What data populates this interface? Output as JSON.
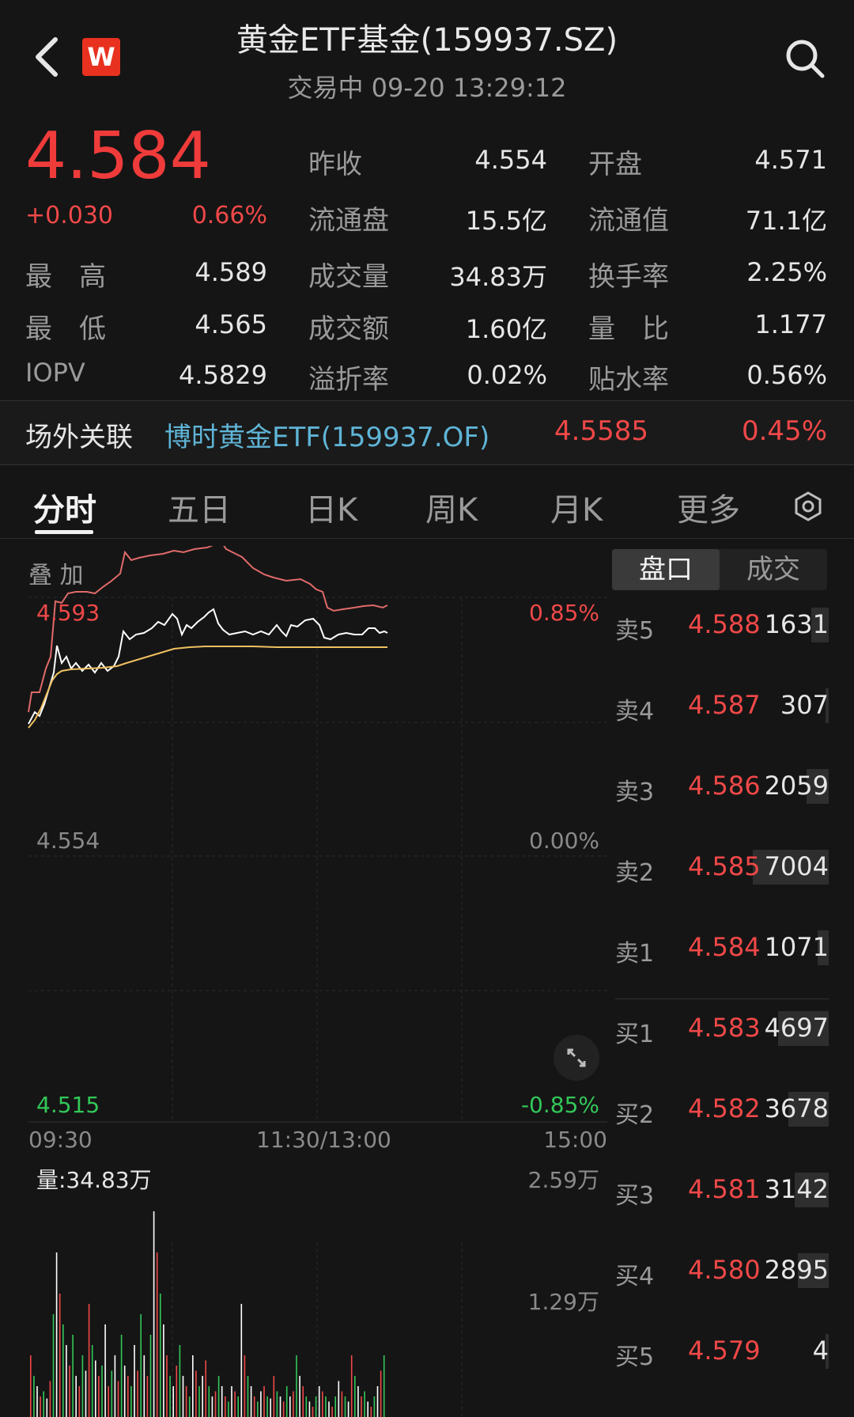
{
  "header": {
    "title": "黄金ETF基金(159937.SZ)",
    "status": "交易中 09-20 13:29:12",
    "logo_letter": "W"
  },
  "quote": {
    "price": "4.584",
    "change": "+0.030",
    "change_pct": "0.66%",
    "high_label": "最　高",
    "high": "4.589",
    "low_label": "最　低",
    "low": "4.565",
    "iopv_label": "IOPV",
    "iopv": "4.5829",
    "prev_close_label": "昨收",
    "prev_close": "4.554",
    "float_shares_label": "流通盘",
    "float_shares": "15.5亿",
    "volume_label": "成交量",
    "volume": "34.83万",
    "turnover_label": "成交额",
    "turnover": "1.60亿",
    "premium_label": "溢折率",
    "premium": "0.02%",
    "open_label": "开盘",
    "open": "4.571",
    "float_value_label": "流通值",
    "float_value": "71.1亿",
    "turnover_rate_label": "换手率",
    "turnover_rate": "2.25%",
    "volume_ratio_label": "量　比",
    "volume_ratio": "1.177",
    "discount_label": "贴水率",
    "discount": "0.56%"
  },
  "related": {
    "label": "场外关联",
    "fund": "博时黄金ETF(159937.OF)",
    "nav": "4.5585",
    "pct": "0.45%"
  },
  "tabs": [
    "分时",
    "五日",
    "日K",
    "周K",
    "月K",
    "更多"
  ],
  "chart": {
    "overlay_label": "叠 加",
    "y_high": "4.593",
    "y_mid": "4.554",
    "y_low": "4.515",
    "pct_high": "0.85%",
    "pct_mid": "0.00%",
    "pct_low": "-0.85%",
    "time_start": "09:30",
    "time_mid": "11:30/13:00",
    "time_end": "15:00",
    "volume_label": "量:34.83万",
    "vol_max": "2.59万",
    "vol_mid": "1.29万",
    "colors": {
      "price": "#ffffff",
      "avg": "#f0c060",
      "compare": "#e06a6a",
      "up": "#f04848",
      "down": "#33c759"
    }
  },
  "chart_data": {
    "type": "line",
    "x_range": [
      "09:30",
      "15:00"
    ],
    "ylim": [
      4.515,
      4.593
    ],
    "series": [],
    "volume_range": [
      0,
      25900
    ]
  },
  "orderbook": {
    "tabs": [
      "盘口",
      "成交"
    ],
    "asks": [
      {
        "side": "卖5",
        "price": "4.588",
        "qty": "1631",
        "ratio": 0.23
      },
      {
        "side": "卖4",
        "price": "4.587",
        "qty": "307",
        "ratio": 0.04
      },
      {
        "side": "卖3",
        "price": "4.586",
        "qty": "2059",
        "ratio": 0.29
      },
      {
        "side": "卖2",
        "price": "4.585",
        "qty": "7004",
        "ratio": 1.0
      },
      {
        "side": "卖1",
        "price": "4.584",
        "qty": "1071",
        "ratio": 0.15
      }
    ],
    "bids": [
      {
        "side": "买1",
        "price": "4.583",
        "qty": "4697",
        "ratio": 0.67
      },
      {
        "side": "买2",
        "price": "4.582",
        "qty": "3678",
        "ratio": 0.53
      },
      {
        "side": "买3",
        "price": "4.581",
        "qty": "3142",
        "ratio": 0.45
      },
      {
        "side": "买4",
        "price": "4.580",
        "qty": "2895",
        "ratio": 0.41
      },
      {
        "side": "买5",
        "price": "4.579",
        "qty": "4",
        "ratio": 0.01
      }
    ]
  }
}
